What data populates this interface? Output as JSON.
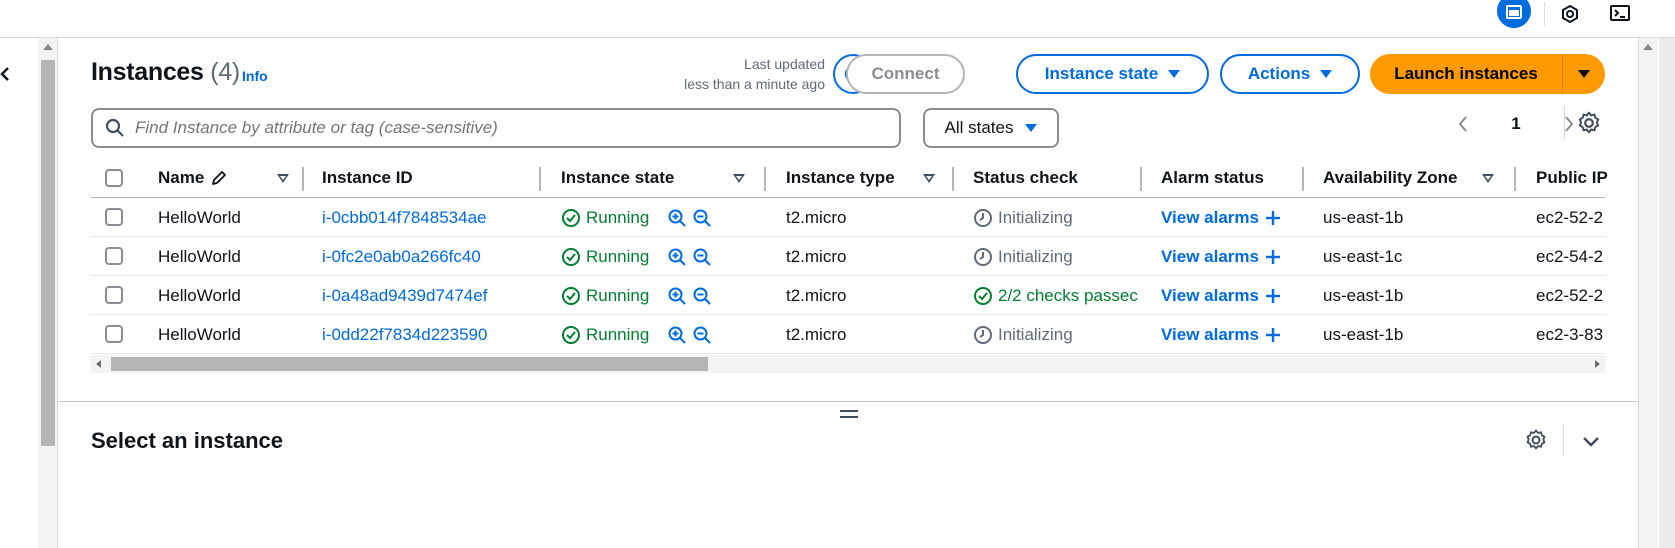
{
  "header": {
    "title": "Instances",
    "count": "(4)",
    "info": "Info",
    "last_updated_line1": "Last updated",
    "last_updated_line2": "less than a minute ago",
    "connect": "Connect",
    "instance_state": "Instance state",
    "actions": "Actions",
    "launch": "Launch instances"
  },
  "filter": {
    "placeholder": "Find Instance by attribute or tag (case-sensitive)",
    "states": "All states",
    "page": "1"
  },
  "columns": [
    "Name",
    "Instance ID",
    "Instance state",
    "Instance type",
    "Status check",
    "Alarm status",
    "Availability Zone",
    "Public IP"
  ],
  "rows": [
    {
      "name": "HelloWorld",
      "id": "i-0cbb014f7848534ae",
      "state": "Running",
      "type": "t2.micro",
      "status": "Initializing",
      "status_ok": false,
      "alarm": "View alarms",
      "az": "us-east-1b",
      "ip": "ec2-52-2"
    },
    {
      "name": "HelloWorld",
      "id": "i-0fc2e0ab0a266fc40",
      "state": "Running",
      "type": "t2.micro",
      "status": "Initializing",
      "status_ok": false,
      "alarm": "View alarms",
      "az": "us-east-1c",
      "ip": "ec2-54-2"
    },
    {
      "name": "HelloWorld",
      "id": "i-0a48ad9439d7474ef",
      "state": "Running",
      "type": "t2.micro",
      "status": "2/2 checks passec",
      "status_ok": true,
      "alarm": "View alarms",
      "az": "us-east-1b",
      "ip": "ec2-52-2"
    },
    {
      "name": "HelloWorld",
      "id": "i-0dd22f7834d223590",
      "state": "Running",
      "type": "t2.micro",
      "status": "Initializing",
      "status_ok": false,
      "alarm": "View alarms",
      "az": "us-east-1b",
      "ip": "ec2-3-83"
    }
  ],
  "details": {
    "title": "Select an instance",
    "drag_glyph": "="
  },
  "colors": {
    "link": "#006ce0",
    "running": "#00802f",
    "launch": "#ff9900"
  },
  "icons": [
    "close-icon",
    "refresh-icon",
    "search-icon",
    "settings-icon",
    "zoom-in-icon",
    "zoom-out-icon",
    "clock-icon",
    "check-circle-icon",
    "plus-icon",
    "edit-icon",
    "chevron-down-icon"
  ]
}
